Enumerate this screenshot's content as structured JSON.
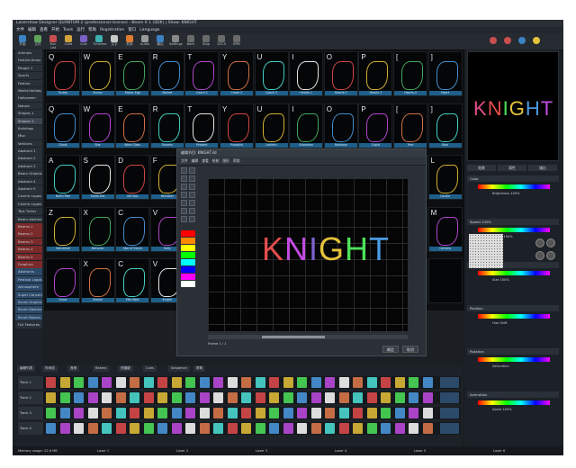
{
  "app": {
    "title": "Lasershow Designer QUANTUM 2 (professional license) - Beam X 1 (SDK) | Show: KNIGHT",
    "menu": [
      "文件",
      "编辑",
      "查看",
      "开始",
      "Tools",
      "运行",
      "帮助",
      "Registration",
      "窗口",
      "Language"
    ],
    "toolbar": [
      {
        "label": "开始",
        "color": "#3b82c4"
      },
      {
        "label": "文件",
        "color": "#5fa45a"
      },
      {
        "label": "Run List",
        "color": "#c94f4f"
      },
      {
        "label": "Cues",
        "color": "#d2a23b"
      },
      {
        "label": "Live",
        "color": "#7b61c8"
      },
      {
        "label": "Timeline",
        "color": "#3fb0b0"
      },
      {
        "label": "文字",
        "color": "#c9c9c9"
      },
      {
        "label": "形状",
        "color": "#e07b2e"
      },
      {
        "label": "Audio",
        "color": "#9a9a9a"
      },
      {
        "label": "输出",
        "color": "#3b82c4"
      },
      {
        "label": "Settings",
        "color": "#888888"
      },
      {
        "label": "Back",
        "color": "#6a6a6a"
      },
      {
        "label": "Stop",
        "color": "#6a6a6a"
      },
      {
        "label": "120.0",
        "color": "#6a6a6a"
      },
      {
        "label": "BPM",
        "color": "#6a6a6a"
      }
    ]
  },
  "left_list": [
    "Animals",
    "Festive-Xmas",
    "People 1",
    "Sports",
    "Festive",
    "World-Holiday",
    "Halloween",
    "Nature",
    "Shapes 1",
    "Shapes 2",
    "Buildings",
    "Misc",
    "Vehicles",
    "Abstract 1",
    "Abstract 2",
    "Abstract 3",
    "Beam Graphics",
    "Abstract 4",
    "Abstract 5",
    "Cosmic Logos",
    "Cosmic Logos",
    "Text Ticker",
    "Beam Abstract",
    "Beams 1",
    "Beams 2",
    "Beams 3",
    "Beams 4",
    "Beams 5",
    "Graphics",
    "Abstracts",
    "Festival Logos",
    "Atmosphere",
    "Super Concert",
    "Brush Graphics",
    "Brush Abstract",
    "Brush Beams",
    "Full Features"
  ],
  "grid": {
    "rows": [
      {
        "keys": [
          "Q",
          "W",
          "E",
          "R",
          "T",
          "Y",
          "U",
          "I",
          "O",
          "P",
          "[",
          "]"
        ],
        "labels": [
          "Turkey",
          "Bunny",
          "Easter Egg",
          "Rocket",
          "Coach 1",
          "Coach 2",
          "Coach 3",
          "Hearts 1",
          "Hearts 2",
          "Hearts 3",
          "Hearts 4",
          "Heart"
        ]
      },
      {
        "keys": [
          "Q",
          "W",
          "E",
          "R",
          "T",
          "Y",
          "U",
          "I",
          "O",
          "P",
          "[",
          "]"
        ],
        "labels": [
          "Ghost",
          "Star",
          "Wine Glass",
          "Flowers",
          "Present",
          "Pumpkin",
          "Lantern",
          "Snowman",
          "Rainbow",
          "Cupid",
          "Tree",
          "Bow"
        ]
      },
      {
        "keys": [
          "A",
          "S",
          "D",
          "F",
          "",
          "",
          "",
          "",
          "",
          "",
          "",
          "L"
        ],
        "labels": [
          "North Pole",
          "Santa Hat",
          "Gift Box",
          "Reindeer",
          "",
          "",
          "",
          "",
          "",
          "",
          "",
          "Candle"
        ]
      },
      {
        "keys": [
          "Z",
          "X",
          "C",
          "V",
          "",
          "",
          "",
          "",
          "",
          "",
          "",
          "M"
        ],
        "labels": [
          "Hanukkah",
          "Menorah",
          "Star of David",
          "Holly",
          "",
          "",
          "",
          "",
          "",
          "",
          "",
          "Camera"
        ]
      },
      {
        "keys": [
          "",
          "X",
          "C",
          "V",
          "",
          "",
          "",
          "",
          "",
          "",
          "",
          ""
        ],
        "labels": [
          "Oscar",
          "Statue",
          "Film Reel",
          "Knight",
          "",
          "",
          "",
          "",
          "",
          "",
          "",
          ""
        ]
      }
    ]
  },
  "preview": {
    "text": "KNIGHT"
  },
  "dialog": {
    "title": "编辑节目: KNIGHT.ild",
    "menu": [
      "文件",
      "编辑",
      "查看",
      "绘制",
      "图形",
      "帮助"
    ],
    "ok": "确定",
    "cancel": "取消",
    "text": "KNIGHT",
    "frame": "Frame 1 / 1"
  },
  "right_panel": {
    "tabs": [
      "效果",
      "属性",
      "输出"
    ],
    "sections": [
      "Color",
      "Speed 100%",
      "Size",
      "Position",
      "Rotation",
      "Animation"
    ],
    "fields": [
      "Brightness 100%",
      "Speed 100%",
      "Size 100%",
      "Hue Shift",
      "Saturation",
      "Alpha 100%"
    ]
  },
  "bottom": {
    "tabs": [
      "编辑列表",
      "时间线",
      "音频",
      "Beams",
      "快捷键",
      "Cues",
      "Sequence",
      "帮助"
    ],
    "tracks": [
      "Track 1",
      "Track 2",
      "Track 3",
      "Track 4"
    ],
    "status": [
      "Memory usage: 22.6 MB",
      "Laser 1",
      "Laser 2",
      "Laser 3",
      "Laser 4",
      "Laser 5",
      "Laser 6"
    ]
  },
  "colors": {
    "accent": "#1f5f8a",
    "bg": "#1b1f24"
  }
}
